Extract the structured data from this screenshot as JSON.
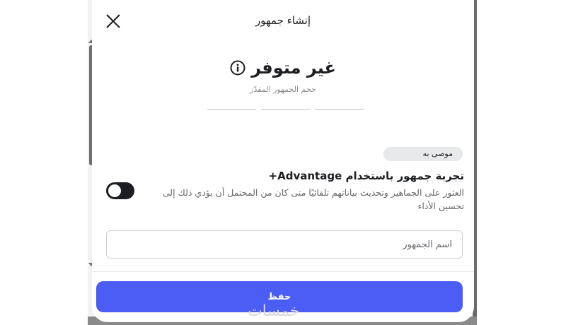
{
  "modal": {
    "title": "إنشاء جمهور",
    "close_icon": "close-icon"
  },
  "audience_size": {
    "value": "غير متوفر",
    "caption": "حجم الجمهور المقدّر",
    "info_icon": "info-icon"
  },
  "advantage": {
    "badge": "موصى به",
    "title": "تجربة جمهور باستخدام Advantage+",
    "description": "العثور على الجماهير وتحديث بياناتهم تلقائيًا متى كان من المحتمل أن يؤدي ذلك إلى تحسين الأداء",
    "toggle_on": true
  },
  "audience_name": {
    "placeholder": "اسم الجمهور",
    "value": ""
  },
  "footer": {
    "save_label": "حفظ"
  },
  "watermark": "خمسات",
  "colors": {
    "primary": "#4b5df5",
    "toggle": "#1c1e21",
    "badge_bg": "#e8e9eb"
  }
}
